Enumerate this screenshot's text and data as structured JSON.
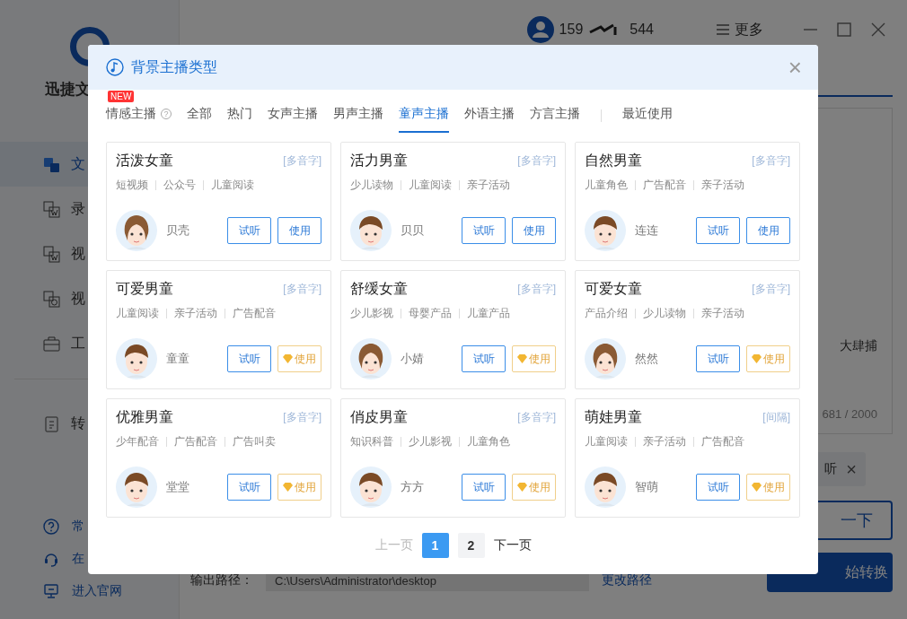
{
  "app": {
    "logo_text": "迅捷文",
    "user_number_start": "159",
    "user_number_end": "544",
    "more_label": "更多",
    "sidebar": {
      "items": [
        {
          "label": "文",
          "selected": true
        },
        {
          "label": "录",
          "selected": false
        },
        {
          "label": "视",
          "selected": false
        },
        {
          "label": "视",
          "selected": false
        },
        {
          "label": "工",
          "selected": false
        },
        {
          "label": "转",
          "selected": false
        }
      ],
      "links": [
        "常",
        "在",
        "进入官网"
      ]
    },
    "editor_text": "大肆捕",
    "char_count": "681 / 2000",
    "chip_label": "听",
    "chip_close": "×",
    "listen_button": "一下",
    "convert_button": "始转换",
    "output_label": "输出路径：",
    "output_path": "C:\\Users\\Administrator\\desktop",
    "change_path": "更改路径"
  },
  "dialog": {
    "title": "背景主播类型",
    "close": "×",
    "tabs": [
      {
        "label": "情感主播",
        "selected": false,
        "badge": "NEW",
        "help": "?"
      },
      {
        "label": "全部",
        "selected": false
      },
      {
        "label": "热门",
        "selected": false
      },
      {
        "label": "女声主播",
        "selected": false
      },
      {
        "label": "男声主播",
        "selected": false
      },
      {
        "label": "童声主播",
        "selected": true
      },
      {
        "label": "外语主播",
        "selected": false
      },
      {
        "label": "方言主播",
        "selected": false
      },
      {
        "label": "最近使用",
        "selected": false
      }
    ],
    "cards": [
      {
        "title": "活泼女童",
        "tag": "[多音字]",
        "categories": [
          "短视频",
          "公众号",
          "儿童阅读"
        ],
        "kind": "girl",
        "voice": "贝壳",
        "listen": "试听",
        "use": "使用",
        "premium": false
      },
      {
        "title": "活力男童",
        "tag": "[多音字]",
        "categories": [
          "少儿读物",
          "儿童阅读",
          "亲子活动"
        ],
        "kind": "boy",
        "voice": "贝贝",
        "listen": "试听",
        "use": "使用",
        "premium": false
      },
      {
        "title": "自然男童",
        "tag": "[多音字]",
        "categories": [
          "儿童角色",
          "广告配音",
          "亲子活动"
        ],
        "kind": "boy",
        "voice": "连连",
        "listen": "试听",
        "use": "使用",
        "premium": false
      },
      {
        "title": "可爱男童",
        "tag": "[多音字]",
        "categories": [
          "儿童阅读",
          "亲子活动",
          "广告配音"
        ],
        "kind": "boy",
        "voice": "童童",
        "listen": "试听",
        "use": "使用",
        "premium": true
      },
      {
        "title": "舒缓女童",
        "tag": "[多音字]",
        "categories": [
          "少儿影视",
          "母婴产品",
          "儿童产品"
        ],
        "kind": "girl",
        "voice": "小婧",
        "listen": "试听",
        "use": "使用",
        "premium": true
      },
      {
        "title": "可爱女童",
        "tag": "[多音字]",
        "categories": [
          "产品介绍",
          "少儿读物",
          "亲子活动"
        ],
        "kind": "girl",
        "voice": "然然",
        "listen": "试听",
        "use": "使用",
        "premium": true
      },
      {
        "title": "优雅男童",
        "tag": "[多音字]",
        "categories": [
          "少年配音",
          "广告配音",
          "广告叫卖"
        ],
        "kind": "boy",
        "voice": "堂堂",
        "listen": "试听",
        "use": "使用",
        "premium": true
      },
      {
        "title": "俏皮男童",
        "tag": "[多音字]",
        "categories": [
          "知识科普",
          "少儿影视",
          "儿童角色"
        ],
        "kind": "boy",
        "voice": "方方",
        "listen": "试听",
        "use": "使用",
        "premium": true
      },
      {
        "title": "萌娃男童",
        "tag": "[间隔]",
        "categories": [
          "儿童阅读",
          "亲子活动",
          "广告配音"
        ],
        "kind": "boy",
        "voice": "智萌",
        "listen": "试听",
        "use": "使用",
        "premium": true
      }
    ],
    "pagination": {
      "prev": {
        "label": "上一页",
        "disabled": true
      },
      "pages": [
        {
          "label": "1",
          "selected": true
        },
        {
          "label": "2",
          "selected": false
        }
      ],
      "next": {
        "label": "下一页",
        "disabled": false
      }
    }
  }
}
